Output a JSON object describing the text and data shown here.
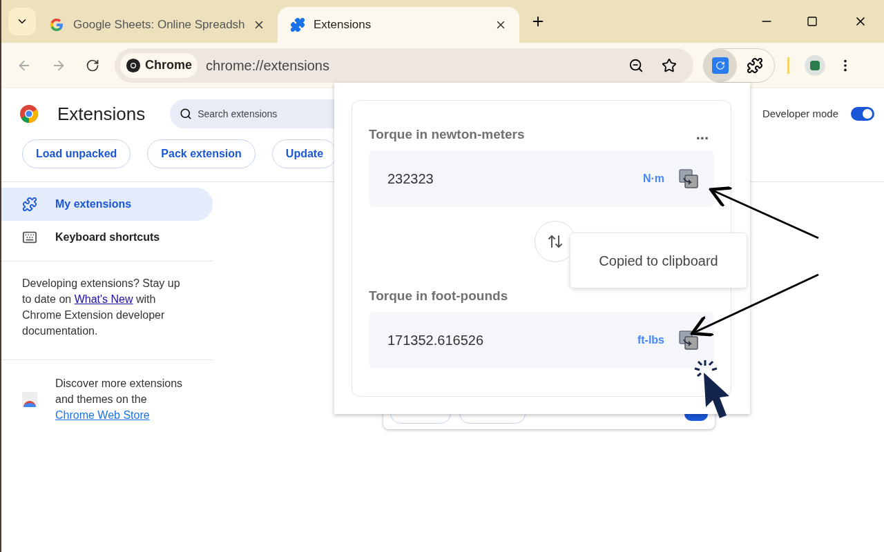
{
  "tabs": [
    {
      "title": "Google Sheets: Online Spreadsh",
      "selected": false
    },
    {
      "title": "Extensions",
      "selected": true
    }
  ],
  "toolbar": {
    "site_chip": "Chrome",
    "url": "chrome://extensions"
  },
  "page": {
    "title": "Extensions",
    "search": {
      "placeholder": "Search extensions"
    },
    "developer_mode": {
      "label": "Developer mode",
      "on": true
    },
    "buttons": [
      "Load unpacked",
      "Pack extension",
      "Update"
    ],
    "sidebar": {
      "items": [
        {
          "label": "My extensions",
          "selected": true,
          "kind": "puzzle"
        },
        {
          "label": "Keyboard shortcuts",
          "selected": false,
          "kind": "keyboard"
        }
      ],
      "info": {
        "before": "Developing extensions? Stay up to date on ",
        "link": "What's New",
        "after": " with Chrome Extension developer documentation."
      },
      "store": {
        "text": "Discover more extensions and themes on the ",
        "link": "Chrome Web Store"
      }
    },
    "extension_card": {
      "enabled": true
    }
  },
  "popup": {
    "fields": [
      {
        "label": "Torque in newton-meters",
        "value": "232323",
        "unit": "N·m"
      },
      {
        "label": "Torque in foot-pounds",
        "value": "171352.616526",
        "unit": "ft-lbs"
      }
    ],
    "more": "...",
    "tooltip": "Copied to clipboard"
  }
}
